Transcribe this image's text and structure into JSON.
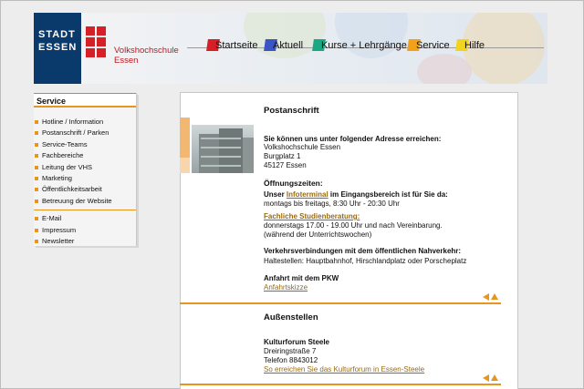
{
  "header": {
    "stadt_logo": [
      "STADT",
      "ESSEN"
    ],
    "vhs_title": [
      "Volkshochschule",
      "Essen"
    ],
    "nav": [
      {
        "label": "Startseite",
        "color": "#d71f26"
      },
      {
        "label": "Aktuell",
        "color": "#3b55c4"
      },
      {
        "label": "Kurse + Lehrgänge",
        "color": "#1aa884"
      },
      {
        "label": "Service",
        "color": "#f1a21a"
      },
      {
        "label": "Hilfe",
        "color": "#f3d41c"
      }
    ]
  },
  "menu": {
    "title": "Service",
    "group1": [
      "Hotline / Information",
      "Postanschrift / Parken",
      "Service-Teams",
      "Fachbereiche",
      "Leitung der VHS",
      "Marketing",
      "Öffentlichkeitsarbeit",
      "Betreuung der Website"
    ],
    "group2": [
      "E-Mail",
      "Impressum",
      "Newsletter"
    ]
  },
  "main": {
    "postanschrift": {
      "heading": "Postanschrift",
      "intro": "Sie können uns unter folgender Adresse erreichen:",
      "address": [
        "Volkshochschule Essen",
        "Burgplatz 1",
        "45127 Essen"
      ]
    },
    "oeffnungszeiten": {
      "heading": "Öffnungszeiten:",
      "prefix": "Unser ",
      "link": "Infoterminal",
      "suffix": " im Eingangsbereich ist für Sie da:",
      "hours": "montags bis freitags, 8:30 Uhr - 20:30 Uhr",
      "beratung_link": "Fachliche Studienberatung:",
      "beratung_1": "donnerstags 17.00 - 19.00 Uhr und nach Vereinbarung.",
      "beratung_2": "(während der Unterrichtswochen)"
    },
    "verkehr": {
      "heading": "Verkehrsverbindungen mit dem öffentlichen Nahverkehr:",
      "text": "Haltestellen: Hauptbahnhof, Hirschlandplatz oder Porscheplatz"
    },
    "pkw": {
      "heading": "Anfahrt mit dem PKW",
      "link": "Anfahrtskizze"
    },
    "aussenstellen": {
      "heading": "Außenstellen",
      "name": "Kulturforum Steele",
      "street": "Dreiringstraße 7",
      "phone": "Telefon 8843012",
      "link": "So erreichen Sie das Kulturforum in Essen-Steele"
    }
  },
  "colors": {
    "accent": "#e8951e",
    "brand_red": "#d71f26",
    "stadt_blue": "#0a3a6c",
    "link": "#9a6a10"
  },
  "icons": [
    "back-arrow-icon",
    "top-arrow-icon"
  ]
}
